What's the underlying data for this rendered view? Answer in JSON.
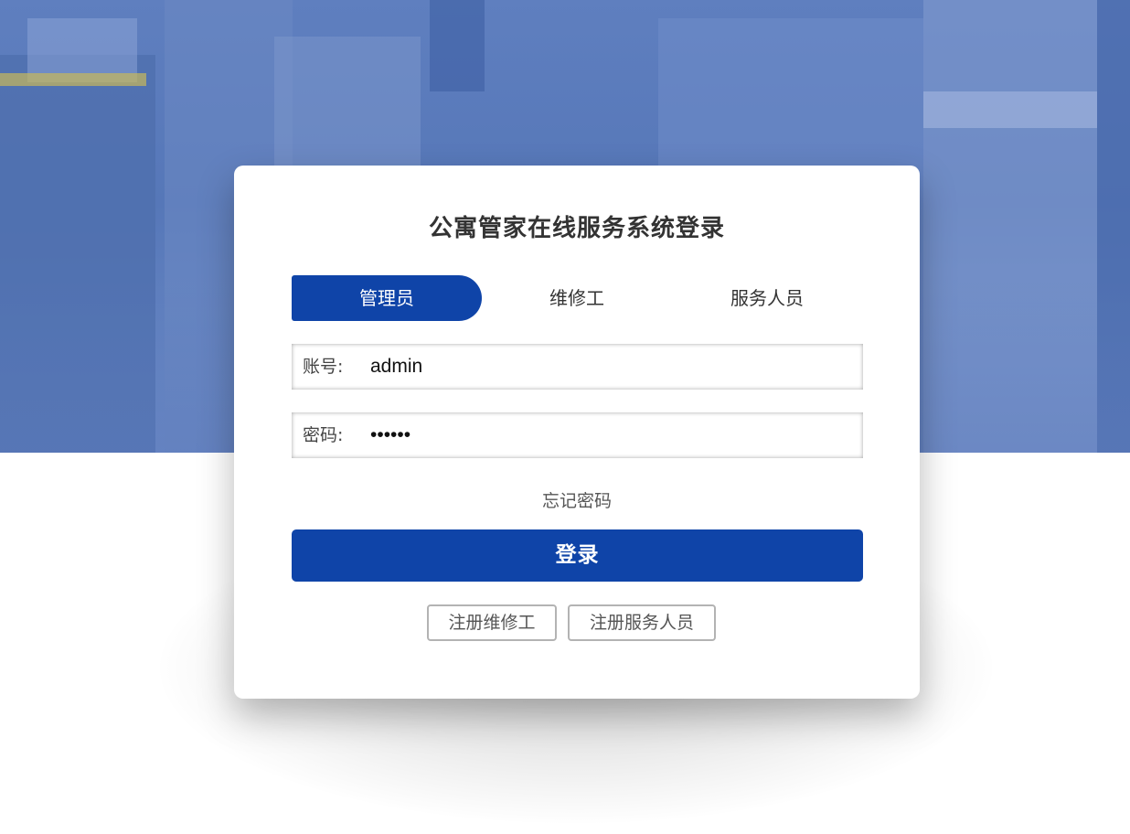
{
  "page": {
    "title": "公寓管家在线服务系统登录"
  },
  "tabs": [
    {
      "label": "管理员",
      "active": true
    },
    {
      "label": "维修工",
      "active": false
    },
    {
      "label": "服务人员",
      "active": false
    }
  ],
  "form": {
    "account_label": "账号:",
    "account_value": "admin",
    "password_label": "密码:",
    "password_value": "••••••"
  },
  "links": {
    "forgot_password": "忘记密码"
  },
  "buttons": {
    "login": "登录",
    "register_repair": "注册维修工",
    "register_service": "注册服务人员"
  },
  "colors": {
    "primary": "#0f44a8",
    "background_photo_tint": "#5f7fbf"
  }
}
